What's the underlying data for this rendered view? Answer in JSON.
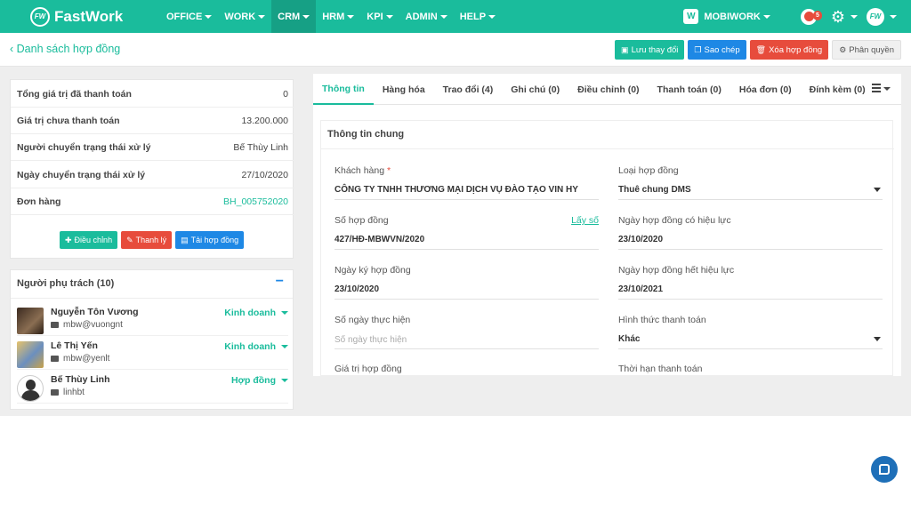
{
  "nav": {
    "logo_badge": "FW",
    "logo_text": "FastWork",
    "menu": [
      {
        "label": "OFFICE",
        "active": false
      },
      {
        "label": "WORK",
        "active": false
      },
      {
        "label": "CRM",
        "active": true
      },
      {
        "label": "HRM",
        "active": false
      },
      {
        "label": "KPI",
        "active": false
      },
      {
        "label": "ADMIN",
        "active": false
      },
      {
        "label": "HELP",
        "active": false
      }
    ],
    "company_logo": "W",
    "company": "MOBIWORK",
    "notification_count": "5",
    "user_avatar": "FW"
  },
  "subheader": {
    "breadcrumb": "‹ Danh sách hợp đồng",
    "save": "Lưu thay đổi",
    "copy": "Sao chép",
    "delete": "Xóa hợp đồng",
    "permission": "Phân quyền"
  },
  "summary": {
    "rows": [
      {
        "label": "Tổng giá trị đã thanh toán",
        "value": "0"
      },
      {
        "label": "Giá trị chưa thanh toán",
        "value": "13.200.000"
      },
      {
        "label": "Người chuyển trạng thái xử lý",
        "value": "Bế Thùy Linh"
      },
      {
        "label": "Ngày chuyển trạng thái xử lý",
        "value": "27/10/2020"
      },
      {
        "label": "Đơn hàng",
        "value": "BH_005752020"
      }
    ],
    "btn_adjust": "Điều chỉnh",
    "btn_liquidate": "Thanh lý",
    "btn_download": "Tải hợp đồng"
  },
  "owners": {
    "title": "Người phụ trách (10)",
    "people": [
      {
        "name": "Nguyễn Tôn Vương",
        "email": "mbw@vuongnt",
        "role": "Kinh doanh"
      },
      {
        "name": "Lê Thị Yến",
        "email": "mbw@yenlt",
        "role": "Kinh doanh"
      },
      {
        "name": "Bế Thùy Linh",
        "email": "linhbt",
        "role": "Hợp đồng"
      }
    ]
  },
  "tabs": [
    "Thông tin",
    "Hàng hóa",
    "Trao đổi (4)",
    "Ghi chú (0)",
    "Điều chỉnh (0)",
    "Thanh toán (0)",
    "Hóa đơn (0)",
    "Đính kèm (0)"
  ],
  "general": {
    "title": "Thông tin chung",
    "customer_label": "Khách hàng",
    "customer_required": "*",
    "customer": "CÔNG TY TNHH THƯƠNG MẠI DỊCH VỤ ĐÀO TẠO VIN HY",
    "contract_type_label": "Loại hợp đồng",
    "contract_type": "Thuê chung DMS",
    "contract_no_label": "Số hợp đồng",
    "get_number": "Lấy số",
    "contract_no": "427/HĐ-MBWVN/2020",
    "effective_date_label": "Ngày hợp đồng có hiệu lực",
    "effective_date": "23/10/2020",
    "sign_date_label": "Ngày ký hợp đồng",
    "sign_date": "23/10/2020",
    "expiry_date_label": "Ngày hợp đồng hết hiệu lực",
    "expiry_date": "23/10/2021",
    "days_label": "Số ngày thực hiện",
    "days_placeholder": "Số ngày thực hiện",
    "payment_method_label": "Hình thức thanh toán",
    "payment_method": "Khác",
    "contract_value_label": "Giá trị hợp đồng",
    "payment_term_label": "Thời hạn thanh toán"
  }
}
